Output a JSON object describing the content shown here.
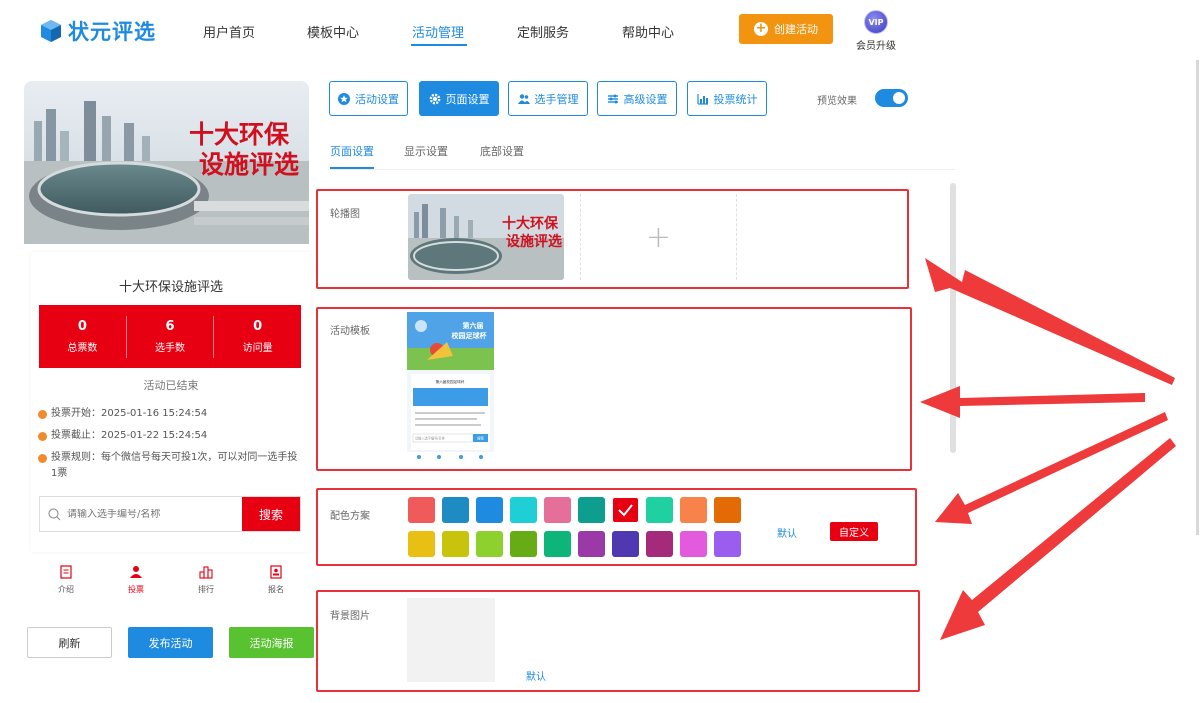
{
  "brand": {
    "logo_text": "状元评选"
  },
  "nav": {
    "items": [
      {
        "label": "用户首页"
      },
      {
        "label": "模板中心"
      },
      {
        "label": "活动管理",
        "active": true
      },
      {
        "label": "定制服务"
      },
      {
        "label": "帮助中心"
      }
    ],
    "create_label": "创建活动",
    "vip_badge": "VIP",
    "vip_label": "会员升级"
  },
  "preview": {
    "banner_text": [
      "十大环保",
      "设施评选"
    ],
    "title": "十大环保设施评选",
    "stats": [
      {
        "value": "0",
        "label": "总票数"
      },
      {
        "value": "6",
        "label": "选手数"
      },
      {
        "value": "0",
        "label": "访问量"
      }
    ],
    "status": "活动已结束",
    "info": [
      "投票开始：2025-01-16 15:24:54",
      "投票截止：2025-01-22 15:24:54",
      "投票规则：每个微信号每天可投1次，可以对同一选手投1票"
    ],
    "search_placeholder": "请输入选手编号/名称",
    "search_label": "搜索",
    "bottom_nav": [
      {
        "label": "介绍",
        "icon": "doc-icon"
      },
      {
        "label": "投票",
        "icon": "person-icon",
        "active": true
      },
      {
        "label": "排行",
        "icon": "rank-icon"
      },
      {
        "label": "报名",
        "icon": "signup-icon"
      }
    ]
  },
  "actions": {
    "refresh": "刷新",
    "publish": "发布活动",
    "poster": "活动海报"
  },
  "tabs": [
    {
      "label": "活动设置",
      "icon": "star-icon"
    },
    {
      "label": "页面设置",
      "icon": "gear-icon",
      "active": true
    },
    {
      "label": "选手管理",
      "icon": "users-icon"
    },
    {
      "label": "高级设置",
      "icon": "sliders-icon"
    },
    {
      "label": "投票统计",
      "icon": "bar-chart-icon"
    }
  ],
  "preview_toggle": {
    "label": "预览效果",
    "on": true
  },
  "subtabs": [
    {
      "label": "页面设置",
      "active": true
    },
    {
      "label": "显示设置"
    },
    {
      "label": "底部设置"
    }
  ],
  "sections": {
    "carousel": {
      "label": "轮播图",
      "thumb_text": [
        "十大环保",
        "设施评选"
      ],
      "add": "+"
    },
    "template": {
      "label": "活动模板",
      "thumb_title": [
        "第六届",
        "校园足球杯"
      ],
      "thumb_subtitle": "第六届校园足球杯",
      "thumb_search": "请输入选手编号/名称",
      "thumb_search_btn": "搜索"
    },
    "colors": {
      "label": "配色方案",
      "row1": [
        "#f05a5a",
        "#1e8bc3",
        "#1f8be0",
        "#1fcfd6",
        "#e4709a",
        "#0e9e90",
        "#e60012",
        "#1fd0a0",
        "#f8834a",
        "#e46a06"
      ],
      "row2": [
        "#e9bf13",
        "#c8c40e",
        "#8ed12e",
        "#68ac15",
        "#0eb57a",
        "#9b3aa6",
        "#5038b0",
        "#a42b7c",
        "#e45adc",
        "#9b5cf0"
      ],
      "selected": "#e60012",
      "default_label": "默认",
      "custom_label": "自定义"
    },
    "background": {
      "label": "背景图片",
      "default_label": "默认"
    }
  },
  "colors": {
    "accent": "#1f8be0",
    "red": "#e60012",
    "orange": "#f39410",
    "annotation": "#e8323a",
    "green": "#58c230"
  }
}
